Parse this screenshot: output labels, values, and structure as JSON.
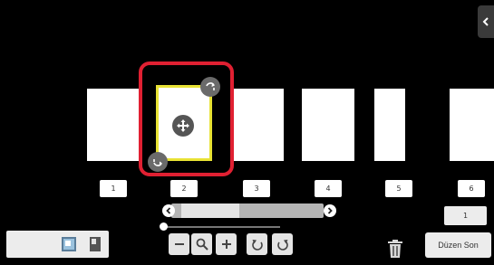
{
  "pages": {
    "numbers": [
      "1",
      "2",
      "3",
      "4",
      "5",
      "6"
    ],
    "selected_index": 2
  },
  "page_counter": "1",
  "finish_button": "Düzen Son",
  "icons": {
    "side_tab": "chevron-left-icon",
    "move": "move-icon",
    "rotate_cw": "rotate-clockwise-icon",
    "rotate_ccw": "rotate-counterclockwise-icon",
    "zoom_out": "minus-icon",
    "zoom": "magnifier-icon",
    "zoom_in": "plus-icon",
    "undo": "undo-icon",
    "redo": "redo-icon",
    "delete": "trash-icon"
  },
  "colors": {
    "selection_border": "#e02032",
    "selected_page_border": "#e8e234",
    "background": "#000000"
  }
}
